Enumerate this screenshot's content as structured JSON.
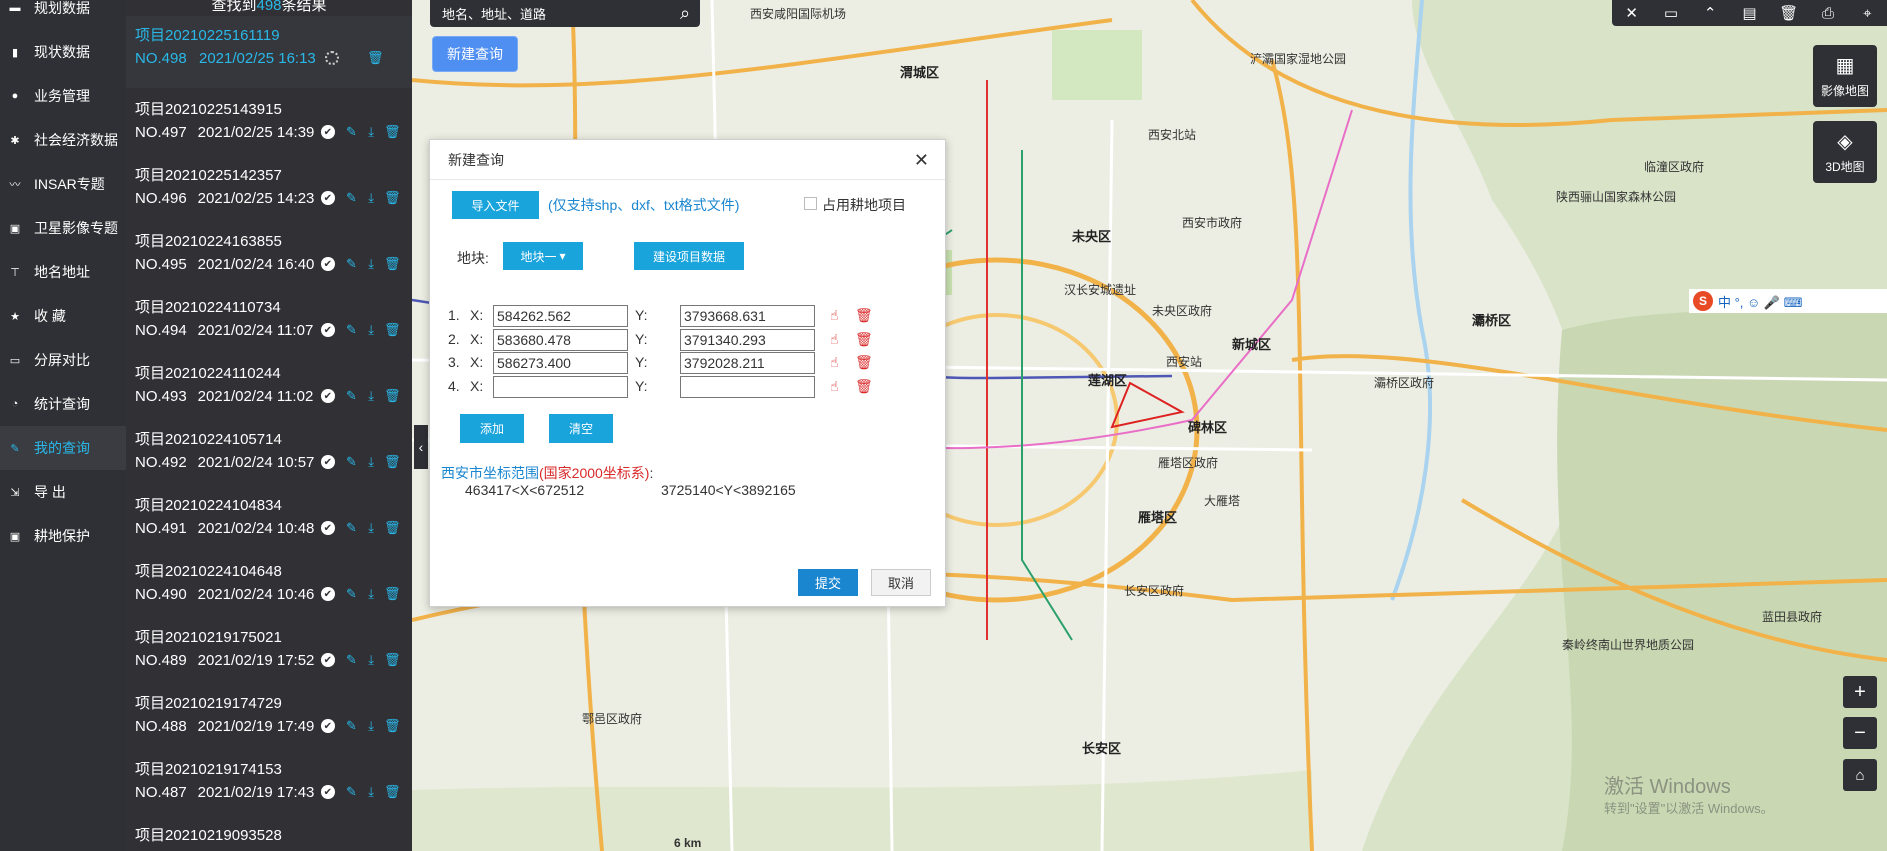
{
  "nav": {
    "items": [
      {
        "label": "规划数据",
        "icon": "layers-icon"
      },
      {
        "label": "现状数据",
        "icon": "bar-chart-icon"
      },
      {
        "label": "业务管理",
        "icon": "user-icon"
      },
      {
        "label": "社会经济数据",
        "icon": "settings-icon"
      },
      {
        "label": "INSAR专题",
        "icon": "line-chart-icon"
      },
      {
        "label": "卫星影像专题",
        "icon": "satellite-icon"
      },
      {
        "label": "地名地址",
        "icon": "location-icon"
      },
      {
        "label": "收 藏",
        "icon": "star-icon"
      },
      {
        "label": "分屏对比",
        "icon": "monitor-icon"
      },
      {
        "label": "统计查询",
        "icon": "pie-chart-icon"
      },
      {
        "label": "我的查询",
        "icon": "edit-icon"
      },
      {
        "label": "导 出",
        "icon": "export-icon"
      },
      {
        "label": "耕地保护",
        "icon": "shield-icon"
      }
    ],
    "active_index": 10
  },
  "list": {
    "header_pre": "查找到",
    "count": "498",
    "header_post": "条结果",
    "rows": [
      {
        "title": "项目20210225161119",
        "no": "NO.498",
        "date": "2021/02/25 16:13",
        "status": "pending"
      },
      {
        "title": "项目20210225143915",
        "no": "NO.497",
        "date": "2021/02/25 14:39",
        "status": "done"
      },
      {
        "title": "项目20210225142357",
        "no": "NO.496",
        "date": "2021/02/25 14:23",
        "status": "done"
      },
      {
        "title": "项目20210224163855",
        "no": "NO.495",
        "date": "2021/02/24 16:40",
        "status": "done"
      },
      {
        "title": "项目20210224110734",
        "no": "NO.494",
        "date": "2021/02/24 11:07",
        "status": "done"
      },
      {
        "title": "项目20210224110244",
        "no": "NO.493",
        "date": "2021/02/24 11:02",
        "status": "done"
      },
      {
        "title": "项目20210224105714",
        "no": "NO.492",
        "date": "2021/02/24 10:57",
        "status": "done"
      },
      {
        "title": "项目20210224104834",
        "no": "NO.491",
        "date": "2021/02/24 10:48",
        "status": "done"
      },
      {
        "title": "项目20210224104648",
        "no": "NO.490",
        "date": "2021/02/24 10:46",
        "status": "done"
      },
      {
        "title": "项目20210219175021",
        "no": "NO.489",
        "date": "2021/02/19 17:52",
        "status": "done"
      },
      {
        "title": "项目20210219174729",
        "no": "NO.488",
        "date": "2021/02/19 17:49",
        "status": "done"
      },
      {
        "title": "项目20210219174153",
        "no": "NO.487",
        "date": "2021/02/19 17:43",
        "status": "done"
      },
      {
        "title": "项目20210219093528",
        "no": "",
        "date": "",
        "status": "done"
      }
    ]
  },
  "search": {
    "placeholder": "地名、地址、道路"
  },
  "new_query_btn": "新建查询",
  "maptypes": {
    "image": "影像地图",
    "threed": "3D地图"
  },
  "ime": {
    "chars": "中 °, ☺ 🎤 ⌨"
  },
  "map": {
    "labels": [
      {
        "t": "渭城区",
        "cls": "big"
      },
      {
        "t": "西安咸阳国际机场",
        "cls": ""
      },
      {
        "t": "未央区",
        "cls": "big"
      },
      {
        "t": "西安市政府",
        "cls": ""
      },
      {
        "t": "未央区政府",
        "cls": ""
      },
      {
        "t": "新城区",
        "cls": "big"
      },
      {
        "t": "莲湖区",
        "cls": "big"
      },
      {
        "t": "碑林区",
        "cls": "big"
      },
      {
        "t": "雁塔区政府",
        "cls": ""
      },
      {
        "t": "雁塔区",
        "cls": "big"
      },
      {
        "t": "灞桥区",
        "cls": "big"
      },
      {
        "t": "灞桥区政府",
        "cls": ""
      },
      {
        "t": "临潼区政府",
        "cls": ""
      },
      {
        "t": "长安区政府",
        "cls": ""
      },
      {
        "t": "长安区",
        "cls": "big"
      },
      {
        "t": "鄠邑区政府",
        "cls": ""
      },
      {
        "t": "蓝田县政府",
        "cls": ""
      },
      {
        "t": "浐灞国家湿地公园",
        "cls": ""
      },
      {
        "t": "陕西骊山国家森林公园",
        "cls": ""
      },
      {
        "t": "秦岭终南山世界地质公园",
        "cls": ""
      },
      {
        "t": "汉长安城遗址",
        "cls": ""
      },
      {
        "t": "大雁塔",
        "cls": ""
      },
      {
        "t": "西安站",
        "cls": ""
      },
      {
        "t": "西安北站",
        "cls": ""
      },
      {
        "t": "6 km",
        "cls": "road"
      },
      {
        "t": "激活 Windows",
        "cls": "road"
      },
      {
        "t": "转到\"设置\"以激活 Windows。",
        "cls": "road"
      }
    ]
  },
  "dialog": {
    "title": "新建查询",
    "import_btn": "导入文件",
    "import_hint": "(仅支持shp、dxf、txt格式文件)",
    "farmland_label": "占用耕地项目",
    "parcel_label": "地块:",
    "parcel_select": "地块一",
    "build_btn": "建设项目数据",
    "x_label": "X:",
    "y_label": "Y:",
    "coords": [
      {
        "idx": "1.",
        "x": "584262.562",
        "y": "3793668.631"
      },
      {
        "idx": "2.",
        "x": "583680.478",
        "y": "3791340.293"
      },
      {
        "idx": "3.",
        "x": "586273.400",
        "y": "3792028.211"
      },
      {
        "idx": "4.",
        "x": "",
        "y": ""
      }
    ],
    "add_btn": "添加",
    "clear_btn": "清空",
    "range_title_a": "西安市坐标范围",
    "range_title_b": "(国家2000坐标系)",
    "range_title_c": ":",
    "range_x": "463417<X<672512",
    "range_y": "3725140<Y<3892165",
    "submit_btn": "提交",
    "cancel_btn": "取消"
  },
  "colors": {
    "accent": "#29b8e8",
    "panel": "#2f3035",
    "button_blue": "#1aa4dc",
    "danger": "#d92a2a"
  }
}
